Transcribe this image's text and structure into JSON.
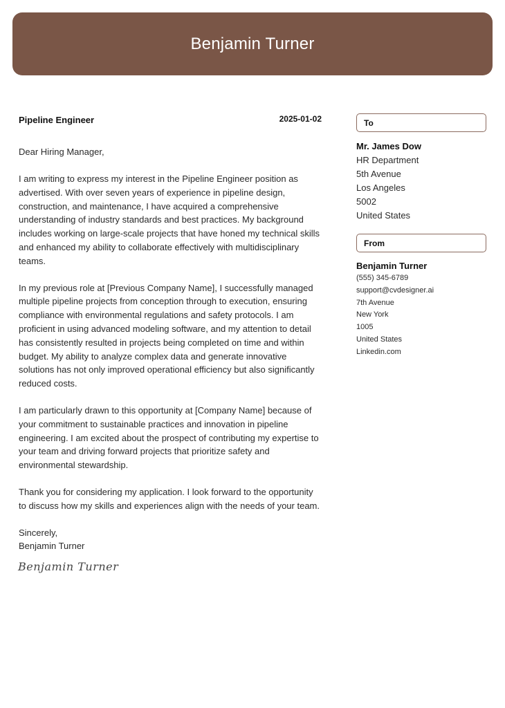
{
  "colors": {
    "header_bg": "#7A5647",
    "box_border": "#8A6A5E"
  },
  "header": {
    "name": "Benjamin Turner"
  },
  "letter": {
    "job_title": "Pipeline Engineer",
    "date": "2025-01-02",
    "salutation": "Dear Hiring Manager,",
    "paragraphs": [
      "I am writing to express my interest in the Pipeline Engineer position as advertised. With over seven years of experience in pipeline design, construction, and maintenance, I have acquired a comprehensive understanding of industry standards and best practices. My background includes working on large-scale projects that have honed my technical skills and enhanced my ability to collaborate effectively with multidisciplinary teams.",
      "In my previous role at [Previous Company Name], I successfully managed multiple pipeline projects from conception through to execution, ensuring compliance with environmental regulations and safety protocols. I am proficient in using advanced modeling software, and my attention to detail has consistently resulted in projects being completed on time and within budget. My ability to analyze complex data and generate innovative solutions has not only improved operational efficiency but also significantly reduced costs.",
      "I am particularly drawn to this opportunity at [Company Name] because of your commitment to sustainable practices and innovation in pipeline engineering. I am excited about the prospect of contributing my expertise to your team and driving forward projects that prioritize safety and environmental stewardship.",
      "Thank you for considering my application. I look forward to the opportunity to discuss how my skills and experiences align with the needs of your team."
    ],
    "closing": "Sincerely,",
    "closing_name": "Benjamin Turner",
    "signature": "Benjamin Turner"
  },
  "recipient": {
    "label": "To",
    "name": "Mr. James Dow",
    "lines": [
      "HR Department",
      "5th Avenue",
      "Los Angeles",
      "5002",
      "United States"
    ]
  },
  "sender": {
    "label": "From",
    "name": "Benjamin Turner",
    "lines": [
      "(555) 345-6789",
      "support@cvdesigner.ai",
      "7th Avenue",
      "New York",
      "1005",
      "United States",
      "Linkedin.com"
    ]
  }
}
